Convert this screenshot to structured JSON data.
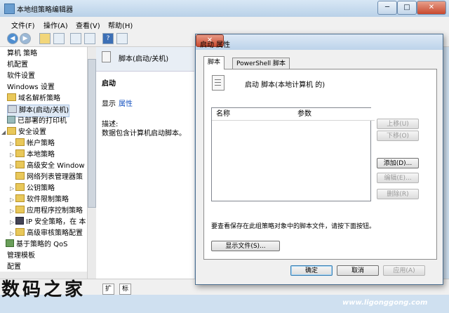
{
  "window": {
    "title": "本地组策略编辑器",
    "minimize": "─",
    "maximize": "□",
    "close": "✕"
  },
  "menu": [
    "文件(F)",
    "操作(A)",
    "查看(V)",
    "帮助(H)"
  ],
  "tree": {
    "items": [
      {
        "label": "算机 策略",
        "indent": 0
      },
      {
        "label": "机配置",
        "indent": 0
      },
      {
        "label": "软件设置",
        "indent": 0
      },
      {
        "label": "Windows 设置",
        "indent": 0
      },
      {
        "label": "域名解析策略",
        "indent": 1
      },
      {
        "label": "脚本(启动/关机)",
        "indent": 1
      },
      {
        "label": "已部署的打印机",
        "indent": 1
      },
      {
        "label": "安全设置",
        "indent": 1
      },
      {
        "label": "帐户策略",
        "indent": 2
      },
      {
        "label": "本地策略",
        "indent": 2
      },
      {
        "label": "高级安全 Window",
        "indent": 2
      },
      {
        "label": "网络列表管理器策",
        "indent": 2
      },
      {
        "label": "公钥策略",
        "indent": 2
      },
      {
        "label": "软件限制策略",
        "indent": 2
      },
      {
        "label": "应用程序控制策略",
        "indent": 2
      },
      {
        "label": "IP 安全策略，在 本",
        "indent": 2
      },
      {
        "label": "高级审核策略配置",
        "indent": 2
      },
      {
        "label": "基于策略的 QoS",
        "indent": 0
      },
      {
        "label": "管理模板",
        "indent": 0
      },
      {
        "label": "配置",
        "indent": 0
      }
    ]
  },
  "pane": {
    "header": "脚本(启动/关机)",
    "name": "启动",
    "show_label": "显示",
    "properties_link": "属性",
    "desc_label": "描述:",
    "desc_text": "数据包含计算机启动脚本。"
  },
  "status_tabs": [
    "扩",
    "标"
  ],
  "dialog": {
    "title": "启动 属性",
    "close": "✕",
    "tabs": [
      "脚本",
      "PowerShell 脚本"
    ],
    "heading": "启动 脚本(本地计算机 的)",
    "columns": [
      "名称",
      "参数"
    ],
    "side_buttons": [
      {
        "label": "上移(U)",
        "enabled": false
      },
      {
        "label": "下移(O)",
        "enabled": false
      },
      {
        "label": "添加(D)...",
        "enabled": true
      },
      {
        "label": "编辑(E)...",
        "enabled": false
      },
      {
        "label": "删除(R)",
        "enabled": false
      }
    ],
    "info": "要查看保存在此组策略对象中的脚本文件，请按下面按钮。",
    "show_files": "显示文件(S)...",
    "ok": "确定",
    "cancel": "取消",
    "apply": "应用(A)"
  },
  "watermark": "数码之家",
  "site": "www.ligonggong.com"
}
